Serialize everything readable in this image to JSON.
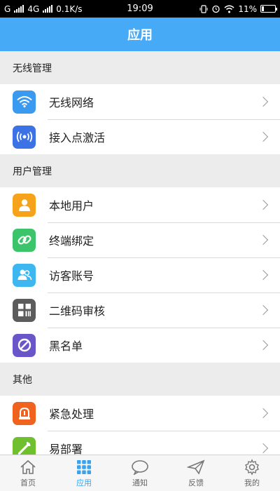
{
  "status_bar": {
    "carrier": "G",
    "network": "4G",
    "speed": "0.1K/s",
    "time": "19:09",
    "battery": "11%"
  },
  "header": {
    "title": "应用"
  },
  "sections": [
    {
      "title": "无线管理",
      "items": [
        {
          "label": "无线网络",
          "icon": "wifi-icon",
          "color": "#3a9af0"
        },
        {
          "label": "接入点激活",
          "icon": "access-point-icon",
          "color": "#3b73e6"
        }
      ]
    },
    {
      "title": "用户管理",
      "items": [
        {
          "label": "本地用户",
          "icon": "user-icon",
          "color": "#f6a21a"
        },
        {
          "label": "终端绑定",
          "icon": "link-icon",
          "color": "#3cc46a"
        },
        {
          "label": "访客账号",
          "icon": "guest-icon",
          "color": "#3eb6f0"
        },
        {
          "label": "二维码审核",
          "icon": "qr-code-icon",
          "color": "#5c5c5c"
        },
        {
          "label": "黑名单",
          "icon": "block-icon",
          "color": "#6b56c9"
        }
      ]
    },
    {
      "title": "其他",
      "items": [
        {
          "label": "紧急处理",
          "icon": "alarm-icon",
          "color": "#f0631e"
        },
        {
          "label": "易部署",
          "icon": "wrench-icon",
          "color": "#6fbf2e"
        }
      ]
    }
  ],
  "bottom_nav": [
    {
      "label": "首页",
      "icon": "home-icon"
    },
    {
      "label": "应用",
      "icon": "apps-grid-icon",
      "active": true
    },
    {
      "label": "通知",
      "icon": "chat-bubble-icon"
    },
    {
      "label": "反馈",
      "icon": "paper-plane-icon"
    },
    {
      "label": "我的",
      "icon": "gear-icon"
    }
  ],
  "colors": {
    "accent": "#46aaf7",
    "active_nav": "#3aa3f0"
  }
}
